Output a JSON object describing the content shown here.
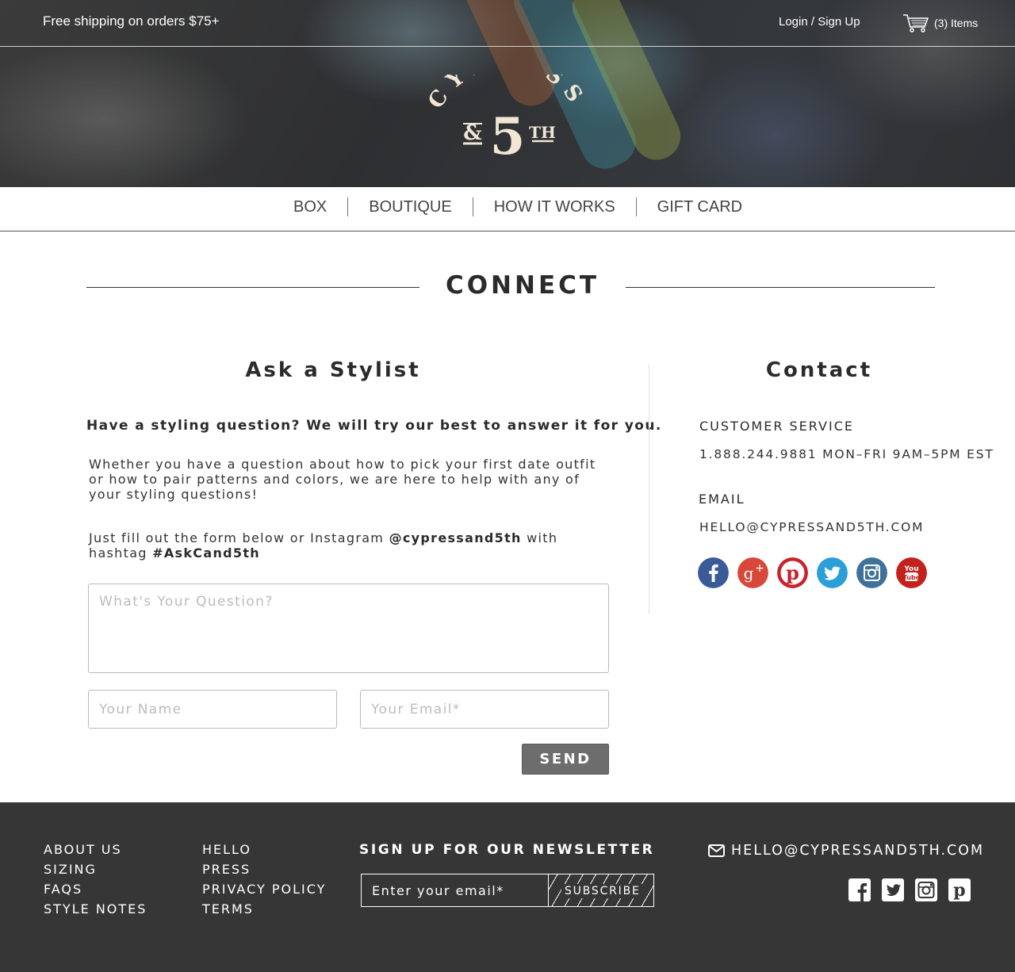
{
  "topbar": {
    "shipping": "Free shipping on orders $75+",
    "login": "Login / Sign Up",
    "cart_count": "(3) Items"
  },
  "brand": {
    "logo_word": "CYPRESS",
    "logo_amp": "&",
    "logo_num": "5",
    "logo_suffix": "TH",
    "logo_color": "#f1e6d4"
  },
  "nav": {
    "items": [
      "BOX",
      "BOUTIQUE",
      "HOW IT WORKS",
      "GIFT CARD"
    ]
  },
  "connect": {
    "title": "CONNECT"
  },
  "stylist": {
    "title": "Ask a Stylist",
    "lead": "Have a styling question? We will try our best to answer it for you.",
    "body": "Whether you have a question about how to pick your first date outfit or how to pair patterns and colors, we are here to help with any of your styling questions!",
    "body2_pre": "Just fill out the form below or Instagram ",
    "instagram_handle": "@cypressand5th",
    "body2_mid": " with hashtag ",
    "hashtag": "#AskCand5th",
    "question_placeholder": "What's Your Question?",
    "name_placeholder": "Your Name",
    "email_placeholder": "Your Email*",
    "send_label": "SEND"
  },
  "contact": {
    "title": "Contact",
    "service_label": "CUSTOMER SERVICE",
    "service_value": "1.888.244.9881 MON–FRI 9AM–5PM EST",
    "email_label": "EMAIL",
    "email_value": "HELLO@CYPRESSAND5TH.COM",
    "social": [
      {
        "name": "facebook-icon",
        "color": "#3a5a98"
      },
      {
        "name": "google-plus-icon",
        "color": "#d8473a"
      },
      {
        "name": "pinterest-icon",
        "color": "#c9222a"
      },
      {
        "name": "twitter-icon",
        "color": "#2a9fd8"
      },
      {
        "name": "instagram-icon",
        "color": "#3f729b"
      },
      {
        "name": "youtube-icon",
        "color": "#c3211c"
      }
    ]
  },
  "footer": {
    "col1": [
      "ABOUT US",
      "SIZING",
      "FAQS",
      "STYLE NOTES"
    ],
    "col2": [
      "HELLO",
      "PRESS",
      "PRIVACY POLICY",
      "TERMS"
    ],
    "newsletter_title": "SIGN UP FOR OUR NEWSLETTER",
    "newsletter_placeholder": "Enter your email*",
    "subscribe_label": "SUBSCRIBE",
    "email": "HELLO@CYPRESSAND5TH.COM",
    "social": [
      "facebook-icon",
      "twitter-icon",
      "instagram-icon",
      "pinterest-icon"
    ],
    "background": "#363636"
  }
}
